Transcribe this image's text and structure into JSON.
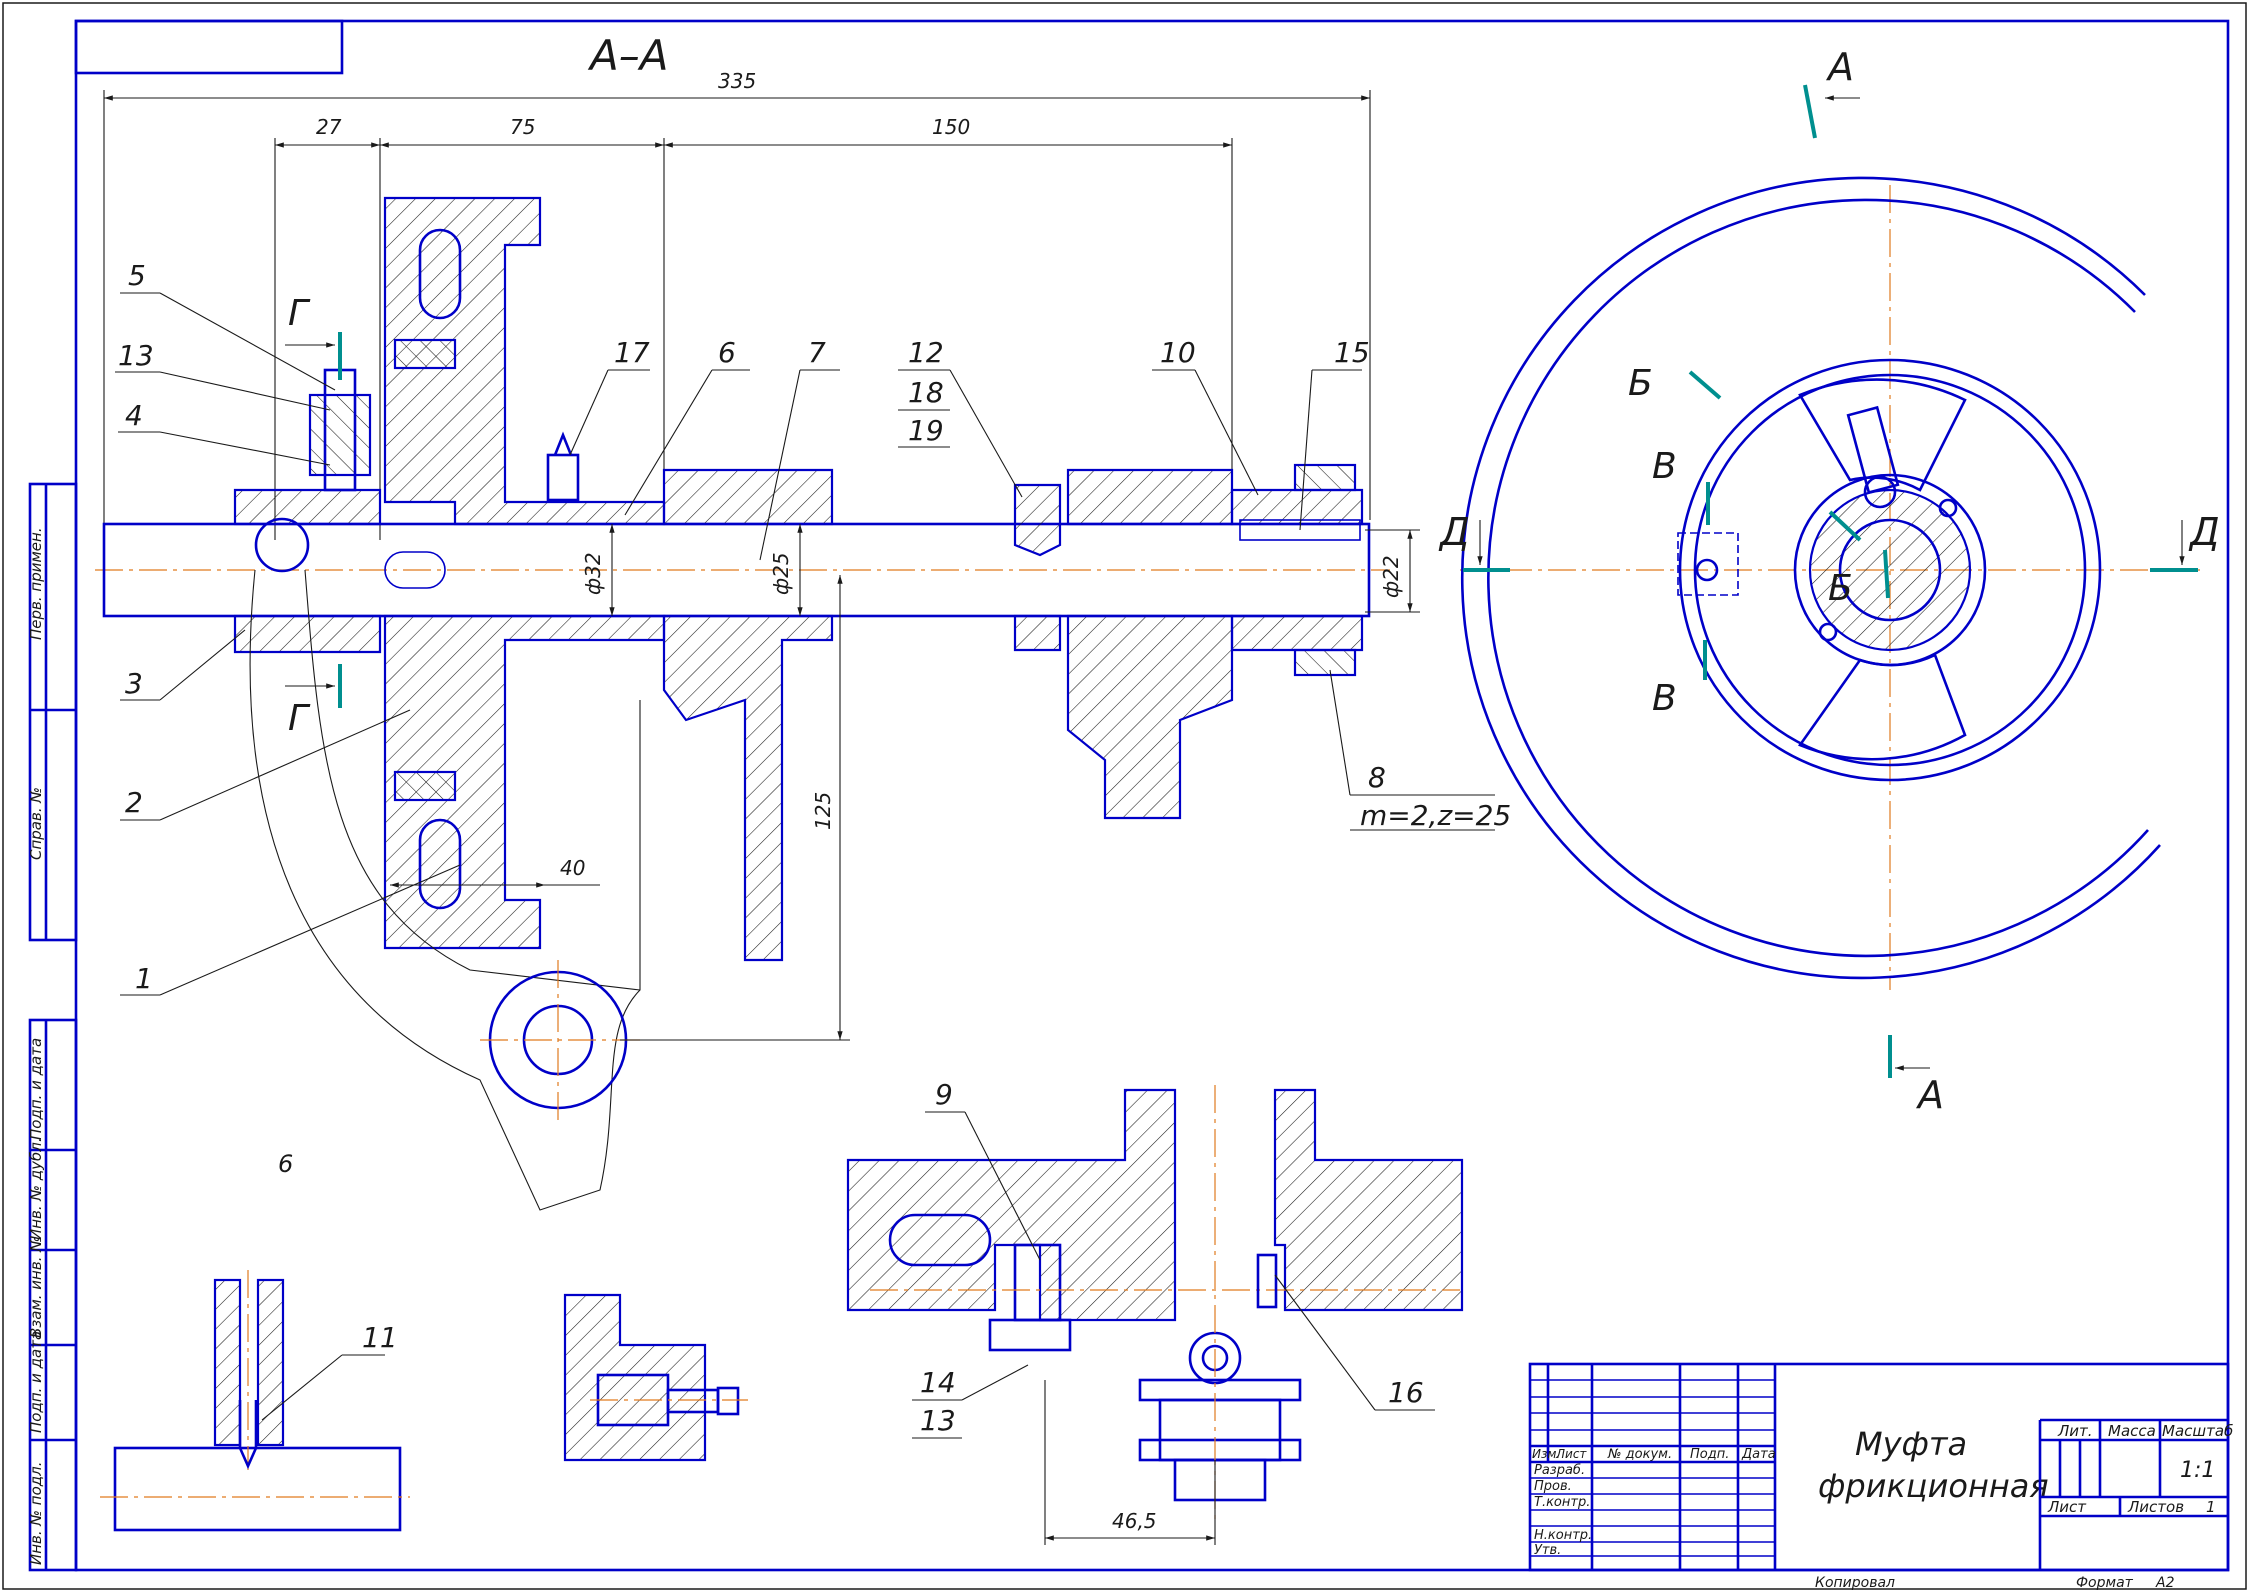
{
  "drawing": {
    "section_title": "А–А",
    "dimensions": {
      "overall": "335",
      "d27": "27",
      "d75": "75",
      "d150": "150",
      "d125": "125",
      "d40": "40",
      "dia32": "ф32",
      "dia25": "ф25",
      "dia22": "ф22",
      "d46_5": "46,5"
    },
    "gear_spec": "m=2,z=25",
    "balloons": [
      "1",
      "2",
      "3",
      "4",
      "5",
      "6",
      "7",
      "8",
      "9",
      "10",
      "11",
      "12",
      "13",
      "14",
      "15",
      "16",
      "17"
    ],
    "stacked_balloons": {
      "b12": "12",
      "b18": "18",
      "b19": "19",
      "b14": "14",
      "b13b": "13"
    },
    "section_marks": {
      "A_top": "А",
      "A_bottom": "А",
      "G_top": "Г",
      "G_bottom": "Г",
      "B1": "Б",
      "B2": "Б",
      "V1": "В",
      "V2": "В",
      "D_left": "Д",
      "D_right": "Д"
    },
    "stray_mark": "6"
  },
  "left_strip": {
    "labels": [
      "Перв. примен.",
      "Справ. №",
      "Подп. и дата",
      "Инв. № дубл.",
      "Взам. инв. №",
      "Подп. и дата",
      "Инв. № подл."
    ]
  },
  "title_block": {
    "title_line1": "Муфта",
    "title_line2": "фрикционная",
    "headers": {
      "izm": "Изм.",
      "list": "Лист",
      "doc": "№ докум.",
      "podp": "Подп.",
      "data": "Дата"
    },
    "rows": [
      "Разраб.",
      "Пров.",
      "Т.контр.",
      "",
      "Н.контр.",
      "Утв."
    ],
    "lit": "Лит.",
    "massa": "Масса",
    "masshtab": "Масштаб",
    "scale_value": "1:1",
    "sheet_label": "Лист",
    "sheets_label": "Листов",
    "sheets_value": "1",
    "copied": "Копировал",
    "format_label": "Формат",
    "format_value": "А2"
  },
  "colors": {
    "line": "#0000c8",
    "center": "#e07a1e",
    "section": "#008f8f"
  }
}
